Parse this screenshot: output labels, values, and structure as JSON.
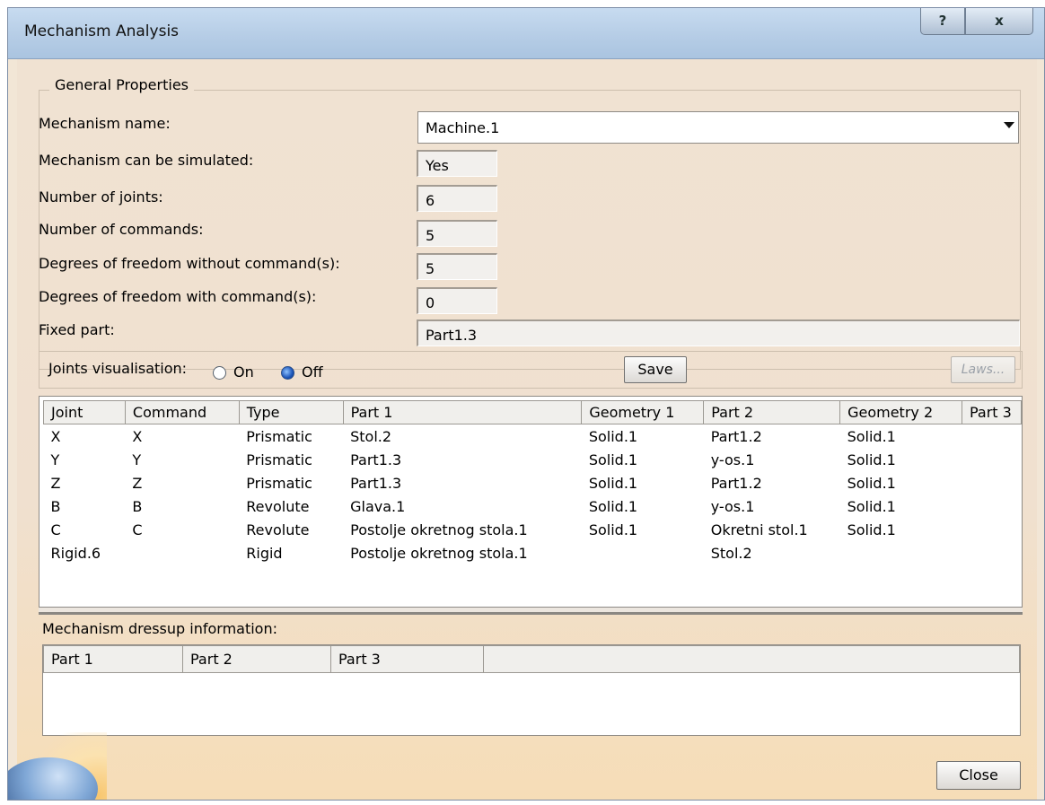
{
  "window": {
    "title": "Mechanism Analysis",
    "help_label": "?",
    "close_label": "x"
  },
  "general": {
    "legend": "General Properties",
    "mechanism_name_label": "Mechanism name:",
    "mechanism_name_value": "Machine.1",
    "can_simulate_label": "Mechanism can be simulated:",
    "can_simulate_value": "Yes",
    "joints_label": "Number of joints:",
    "joints_value": "6",
    "commands_label": "Number of commands:",
    "commands_value": "5",
    "dof_without_label": "Degrees of freedom without command(s):",
    "dof_without_value": "5",
    "dof_with_label": "Degrees of freedom with command(s):",
    "dof_with_value": "0",
    "fixed_part_label": "Fixed part:",
    "fixed_part_value": "Part1.3"
  },
  "visualisation": {
    "label": "Joints visualisation:",
    "on_label": "On",
    "off_label": "Off",
    "selected": "Off",
    "save_label": "Save",
    "laws_label": "Laws..."
  },
  "joints_table": {
    "headers": [
      "Joint",
      "Command",
      "Type",
      "Part 1",
      "Geometry 1",
      "Part 2",
      "Geometry 2",
      "Part 3"
    ],
    "rows": [
      [
        "X",
        "X",
        "Prismatic",
        "Stol.2",
        "Solid.1",
        "Part1.2",
        "Solid.1",
        ""
      ],
      [
        "Y",
        "Y",
        "Prismatic",
        "Part1.3",
        "Solid.1",
        "y-os.1",
        "Solid.1",
        ""
      ],
      [
        "Z",
        "Z",
        "Prismatic",
        "Part1.3",
        "Solid.1",
        "Part1.2",
        "Solid.1",
        ""
      ],
      [
        "B",
        "B",
        "Revolute",
        "Glava.1",
        "Solid.1",
        "y-os.1",
        "Solid.1",
        ""
      ],
      [
        "C",
        "C",
        "Revolute",
        "Postolje okretnog stola.1",
        "Solid.1",
        "Okretni stol.1",
        "Solid.1",
        ""
      ],
      [
        "Rigid.6",
        "",
        "Rigid",
        "Postolje okretnog stola.1",
        "",
        "Stol.2",
        "",
        ""
      ]
    ]
  },
  "dressup": {
    "label": "Mechanism dressup information:",
    "headers": [
      "Part 1",
      "Part 2",
      "Part 3",
      ""
    ]
  },
  "footer": {
    "close_label": "Close"
  }
}
